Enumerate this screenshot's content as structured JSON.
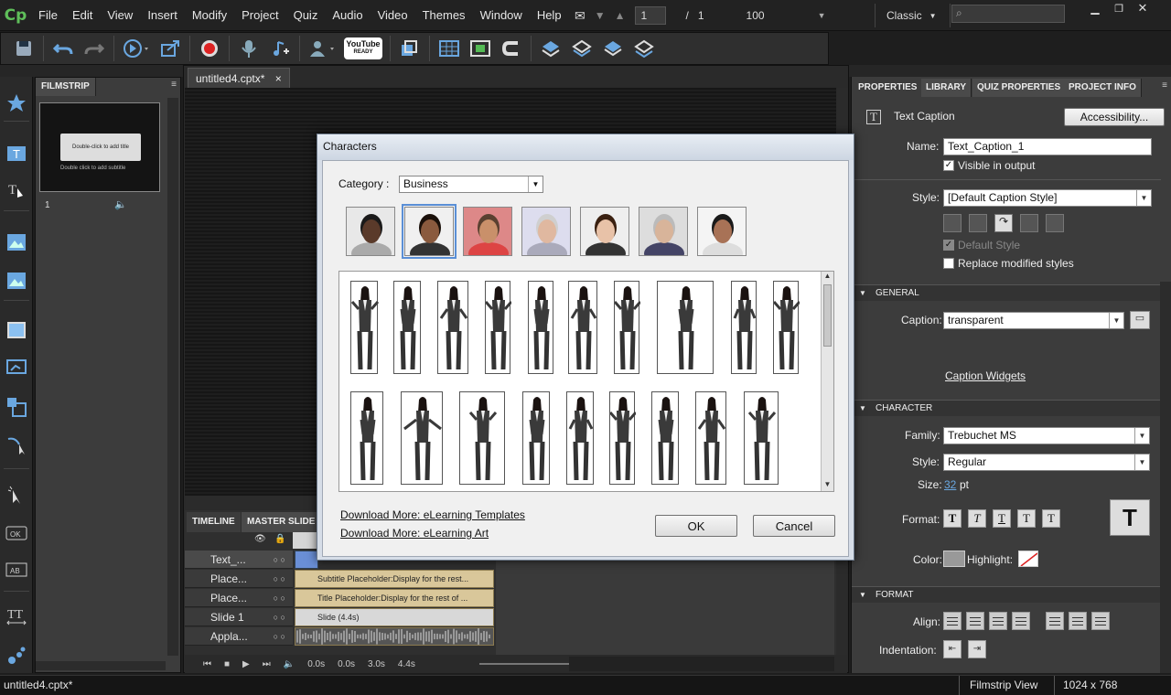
{
  "app": {
    "logo": "Cp"
  },
  "menu": [
    "File",
    "Edit",
    "View",
    "Insert",
    "Modify",
    "Project",
    "Quiz",
    "Audio",
    "Video",
    "Themes",
    "Window",
    "Help"
  ],
  "slide_nav": {
    "current": "1",
    "separator": "/",
    "total": "1",
    "zoom": "100"
  },
  "workspace": {
    "name": "Classic"
  },
  "search": {
    "placeholder": ""
  },
  "toolbar": {
    "youtube_label": "YouTube",
    "youtube_sub": "READY"
  },
  "filmstrip": {
    "tab": "FILMSTRIP",
    "thumb_title": "Double-click to add title",
    "thumb_subtitle": "Double click to add subtitle",
    "slide_number": "1"
  },
  "document": {
    "tab": "untitled4.cptx*",
    "close": "×"
  },
  "timeline": {
    "tabs": [
      "TIMELINE",
      "MASTER SLIDE"
    ],
    "rows": [
      {
        "label": "Text_...",
        "bar": ""
      },
      {
        "label": "Place...",
        "bar": "Subtitle Placeholder:Display for the rest..."
      },
      {
        "label": "Place...",
        "bar": "Title Placeholder:Display for the rest of ..."
      },
      {
        "label": "Slide 1",
        "bar": "Slide (4.4s)"
      },
      {
        "label": "Appla...",
        "bar": ""
      }
    ],
    "times": [
      "0.0s",
      "0.0s",
      "3.0s",
      "4.4s"
    ]
  },
  "properties": {
    "tabs": [
      "PROPERTIES",
      "LIBRARY",
      "QUIZ PROPERTIES",
      "PROJECT INFO"
    ],
    "object_type": "Text Caption",
    "accessibility": "Accessibility...",
    "name_label": "Name:",
    "name_value": "Text_Caption_1",
    "visible_label": "Visible in output",
    "style_label": "Style:",
    "style_value": "[Default Caption Style]",
    "default_style_label": "Default Style",
    "replace_label": "Replace modified styles",
    "general_section": "GENERAL",
    "caption_label": "Caption:",
    "caption_value": "transparent",
    "caption_widgets": "Caption Widgets",
    "character_section": "CHARACTER",
    "family_label": "Family:",
    "family_value": "Trebuchet MS",
    "char_style_label": "Style:",
    "char_style_value": "Regular",
    "size_label": "Size:",
    "size_value": "32",
    "size_unit": "pt",
    "format_label": "Format:",
    "format_buttons": [
      "T",
      "T",
      "T",
      "T",
      "T"
    ],
    "big_t": "T",
    "color_label": "Color:",
    "highlight_label": "Highlight:",
    "format_section": "FORMAT",
    "align_label": "Align:",
    "indentation_label": "Indentation:"
  },
  "status": {
    "file": "untitled4.cptx*",
    "view": "Filmstrip View",
    "resolution": "1024 x 768"
  },
  "dialog": {
    "title": "Characters",
    "category_label": "Category :",
    "category_value": "Business",
    "download_templates": "Download More: eLearning Templates",
    "download_art": "Download More: eLearning Art",
    "ok": "OK",
    "cancel": "Cancel"
  }
}
